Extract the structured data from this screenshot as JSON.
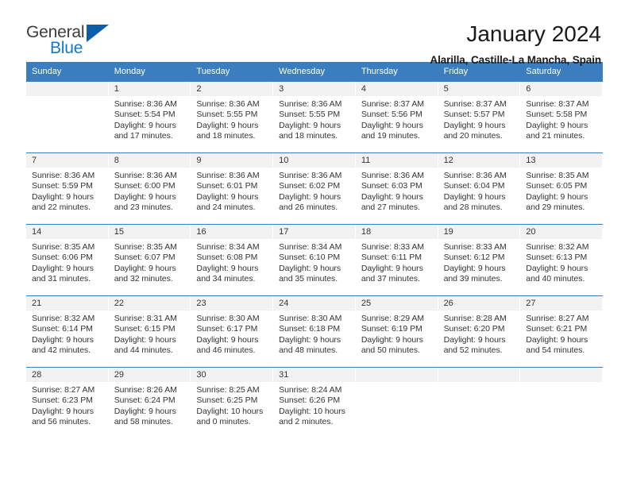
{
  "brand": {
    "name_part1": "General",
    "name_part2": "Blue",
    "triangle_color": "#0a5fa8",
    "blue_color": "#1278c8"
  },
  "header": {
    "title": "January 2024",
    "subtitle": "Alarilla, Castille-La Mancha, Spain"
  },
  "theme": {
    "header_blue": "#3a7ebf",
    "day_band_gray": "#f2f2f2",
    "text_color": "#333333"
  },
  "weekdays": [
    "Sunday",
    "Monday",
    "Tuesday",
    "Wednesday",
    "Thursday",
    "Friday",
    "Saturday"
  ],
  "weeks": [
    [
      {
        "day": "",
        "sunrise": "",
        "sunset": "",
        "daylight_line1": "",
        "daylight_line2": ""
      },
      {
        "day": "1",
        "sunrise": "Sunrise: 8:36 AM",
        "sunset": "Sunset: 5:54 PM",
        "daylight_line1": "Daylight: 9 hours",
        "daylight_line2": "and 17 minutes."
      },
      {
        "day": "2",
        "sunrise": "Sunrise: 8:36 AM",
        "sunset": "Sunset: 5:55 PM",
        "daylight_line1": "Daylight: 9 hours",
        "daylight_line2": "and 18 minutes."
      },
      {
        "day": "3",
        "sunrise": "Sunrise: 8:36 AM",
        "sunset": "Sunset: 5:55 PM",
        "daylight_line1": "Daylight: 9 hours",
        "daylight_line2": "and 18 minutes."
      },
      {
        "day": "4",
        "sunrise": "Sunrise: 8:37 AM",
        "sunset": "Sunset: 5:56 PM",
        "daylight_line1": "Daylight: 9 hours",
        "daylight_line2": "and 19 minutes."
      },
      {
        "day": "5",
        "sunrise": "Sunrise: 8:37 AM",
        "sunset": "Sunset: 5:57 PM",
        "daylight_line1": "Daylight: 9 hours",
        "daylight_line2": "and 20 minutes."
      },
      {
        "day": "6",
        "sunrise": "Sunrise: 8:37 AM",
        "sunset": "Sunset: 5:58 PM",
        "daylight_line1": "Daylight: 9 hours",
        "daylight_line2": "and 21 minutes."
      }
    ],
    [
      {
        "day": "7",
        "sunrise": "Sunrise: 8:36 AM",
        "sunset": "Sunset: 5:59 PM",
        "daylight_line1": "Daylight: 9 hours",
        "daylight_line2": "and 22 minutes."
      },
      {
        "day": "8",
        "sunrise": "Sunrise: 8:36 AM",
        "sunset": "Sunset: 6:00 PM",
        "daylight_line1": "Daylight: 9 hours",
        "daylight_line2": "and 23 minutes."
      },
      {
        "day": "9",
        "sunrise": "Sunrise: 8:36 AM",
        "sunset": "Sunset: 6:01 PM",
        "daylight_line1": "Daylight: 9 hours",
        "daylight_line2": "and 24 minutes."
      },
      {
        "day": "10",
        "sunrise": "Sunrise: 8:36 AM",
        "sunset": "Sunset: 6:02 PM",
        "daylight_line1": "Daylight: 9 hours",
        "daylight_line2": "and 26 minutes."
      },
      {
        "day": "11",
        "sunrise": "Sunrise: 8:36 AM",
        "sunset": "Sunset: 6:03 PM",
        "daylight_line1": "Daylight: 9 hours",
        "daylight_line2": "and 27 minutes."
      },
      {
        "day": "12",
        "sunrise": "Sunrise: 8:36 AM",
        "sunset": "Sunset: 6:04 PM",
        "daylight_line1": "Daylight: 9 hours",
        "daylight_line2": "and 28 minutes."
      },
      {
        "day": "13",
        "sunrise": "Sunrise: 8:35 AM",
        "sunset": "Sunset: 6:05 PM",
        "daylight_line1": "Daylight: 9 hours",
        "daylight_line2": "and 29 minutes."
      }
    ],
    [
      {
        "day": "14",
        "sunrise": "Sunrise: 8:35 AM",
        "sunset": "Sunset: 6:06 PM",
        "daylight_line1": "Daylight: 9 hours",
        "daylight_line2": "and 31 minutes."
      },
      {
        "day": "15",
        "sunrise": "Sunrise: 8:35 AM",
        "sunset": "Sunset: 6:07 PM",
        "daylight_line1": "Daylight: 9 hours",
        "daylight_line2": "and 32 minutes."
      },
      {
        "day": "16",
        "sunrise": "Sunrise: 8:34 AM",
        "sunset": "Sunset: 6:08 PM",
        "daylight_line1": "Daylight: 9 hours",
        "daylight_line2": "and 34 minutes."
      },
      {
        "day": "17",
        "sunrise": "Sunrise: 8:34 AM",
        "sunset": "Sunset: 6:10 PM",
        "daylight_line1": "Daylight: 9 hours",
        "daylight_line2": "and 35 minutes."
      },
      {
        "day": "18",
        "sunrise": "Sunrise: 8:33 AM",
        "sunset": "Sunset: 6:11 PM",
        "daylight_line1": "Daylight: 9 hours",
        "daylight_line2": "and 37 minutes."
      },
      {
        "day": "19",
        "sunrise": "Sunrise: 8:33 AM",
        "sunset": "Sunset: 6:12 PM",
        "daylight_line1": "Daylight: 9 hours",
        "daylight_line2": "and 39 minutes."
      },
      {
        "day": "20",
        "sunrise": "Sunrise: 8:32 AM",
        "sunset": "Sunset: 6:13 PM",
        "daylight_line1": "Daylight: 9 hours",
        "daylight_line2": "and 40 minutes."
      }
    ],
    [
      {
        "day": "21",
        "sunrise": "Sunrise: 8:32 AM",
        "sunset": "Sunset: 6:14 PM",
        "daylight_line1": "Daylight: 9 hours",
        "daylight_line2": "and 42 minutes."
      },
      {
        "day": "22",
        "sunrise": "Sunrise: 8:31 AM",
        "sunset": "Sunset: 6:15 PM",
        "daylight_line1": "Daylight: 9 hours",
        "daylight_line2": "and 44 minutes."
      },
      {
        "day": "23",
        "sunrise": "Sunrise: 8:30 AM",
        "sunset": "Sunset: 6:17 PM",
        "daylight_line1": "Daylight: 9 hours",
        "daylight_line2": "and 46 minutes."
      },
      {
        "day": "24",
        "sunrise": "Sunrise: 8:30 AM",
        "sunset": "Sunset: 6:18 PM",
        "daylight_line1": "Daylight: 9 hours",
        "daylight_line2": "and 48 minutes."
      },
      {
        "day": "25",
        "sunrise": "Sunrise: 8:29 AM",
        "sunset": "Sunset: 6:19 PM",
        "daylight_line1": "Daylight: 9 hours",
        "daylight_line2": "and 50 minutes."
      },
      {
        "day": "26",
        "sunrise": "Sunrise: 8:28 AM",
        "sunset": "Sunset: 6:20 PM",
        "daylight_line1": "Daylight: 9 hours",
        "daylight_line2": "and 52 minutes."
      },
      {
        "day": "27",
        "sunrise": "Sunrise: 8:27 AM",
        "sunset": "Sunset: 6:21 PM",
        "daylight_line1": "Daylight: 9 hours",
        "daylight_line2": "and 54 minutes."
      }
    ],
    [
      {
        "day": "28",
        "sunrise": "Sunrise: 8:27 AM",
        "sunset": "Sunset: 6:23 PM",
        "daylight_line1": "Daylight: 9 hours",
        "daylight_line2": "and 56 minutes."
      },
      {
        "day": "29",
        "sunrise": "Sunrise: 8:26 AM",
        "sunset": "Sunset: 6:24 PM",
        "daylight_line1": "Daylight: 9 hours",
        "daylight_line2": "and 58 minutes."
      },
      {
        "day": "30",
        "sunrise": "Sunrise: 8:25 AM",
        "sunset": "Sunset: 6:25 PM",
        "daylight_line1": "Daylight: 10 hours",
        "daylight_line2": "and 0 minutes."
      },
      {
        "day": "31",
        "sunrise": "Sunrise: 8:24 AM",
        "sunset": "Sunset: 6:26 PM",
        "daylight_line1": "Daylight: 10 hours",
        "daylight_line2": "and 2 minutes."
      },
      {
        "day": "",
        "sunrise": "",
        "sunset": "",
        "daylight_line1": "",
        "daylight_line2": ""
      },
      {
        "day": "",
        "sunrise": "",
        "sunset": "",
        "daylight_line1": "",
        "daylight_line2": ""
      },
      {
        "day": "",
        "sunrise": "",
        "sunset": "",
        "daylight_line1": "",
        "daylight_line2": ""
      }
    ]
  ]
}
